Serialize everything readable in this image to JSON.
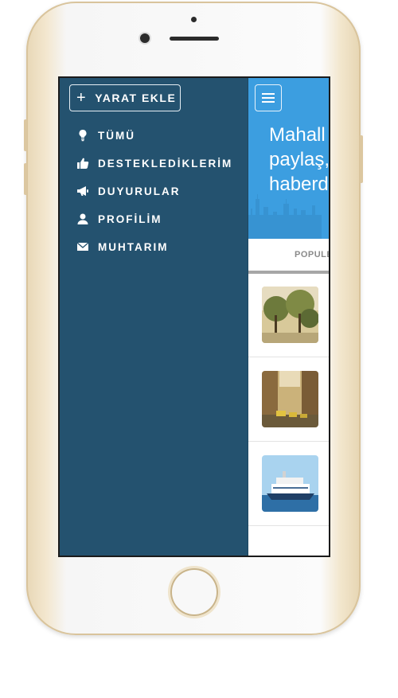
{
  "sidebar": {
    "add_button_label": "YARAT EKLE",
    "items": [
      {
        "label": "TÜMÜ",
        "icon": "lightbulb-icon"
      },
      {
        "label": "DESTEKLEDİKLERİM",
        "icon": "thumbs-up-icon"
      },
      {
        "label": "DUYURULAR",
        "icon": "megaphone-icon"
      },
      {
        "label": "PROFİLİM",
        "icon": "user-icon"
      },
      {
        "label": "MUHTARIM",
        "icon": "envelope-icon"
      }
    ]
  },
  "main": {
    "hero_text": "Mahall\npaylaş,\nhaberd",
    "tab_label": "POPULE",
    "feed": [
      {
        "thumb": "street-trees-photo"
      },
      {
        "thumb": "city-street-traffic-photo"
      },
      {
        "thumb": "ferry-boat-photo"
      }
    ]
  },
  "colors": {
    "sidebar_bg": "#24526f",
    "hero_bg": "#3c9ee0",
    "tab_underline": "#a6a6a6"
  }
}
